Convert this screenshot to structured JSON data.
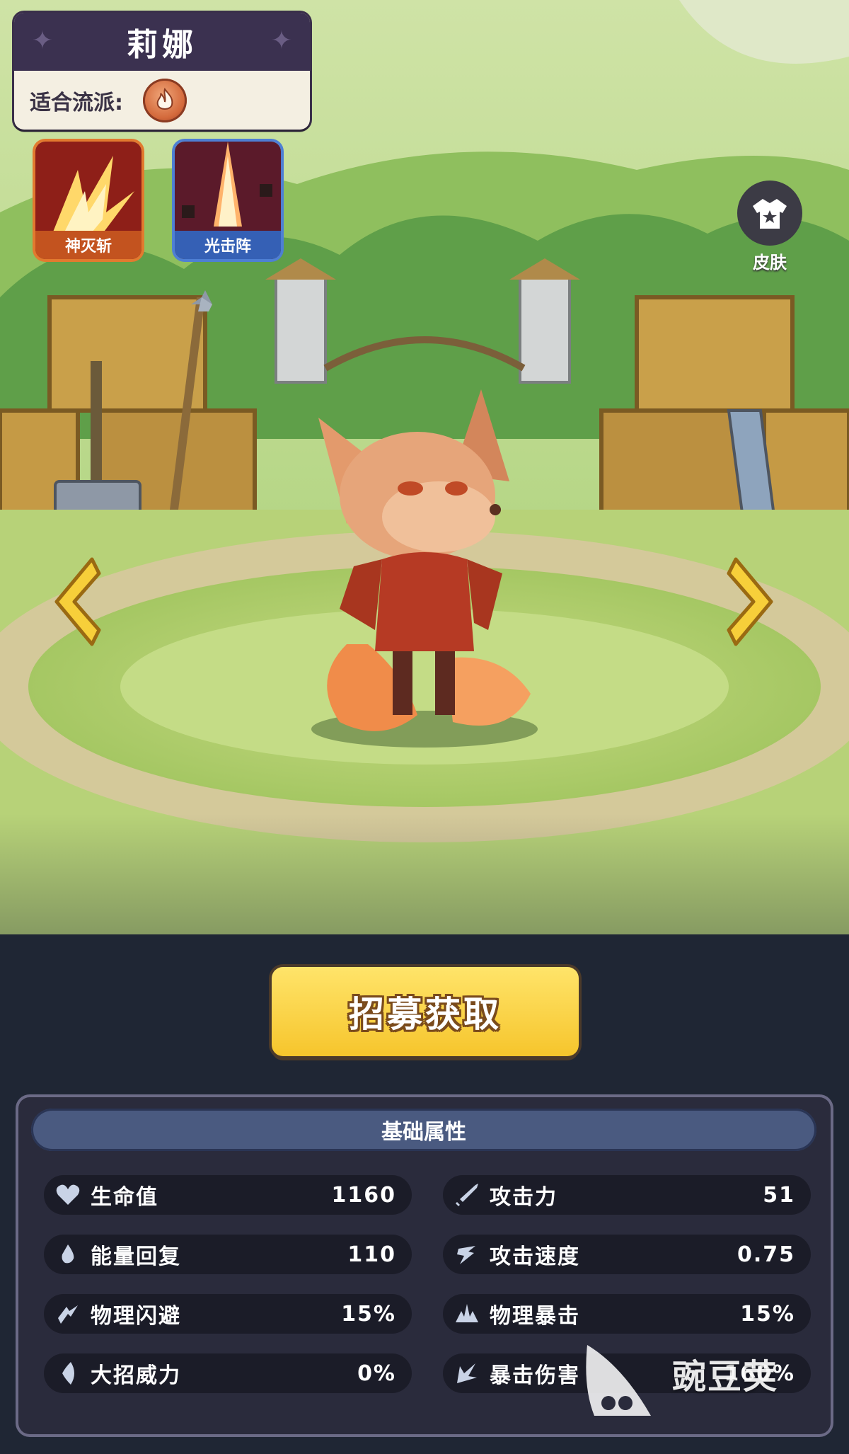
{
  "hero": {
    "name": "莉娜",
    "school_label": "适合流派:",
    "school_icon": "fire-flame-icon"
  },
  "skills": [
    {
      "label": "神灭斩",
      "icon": "flame-slash-icon",
      "color": "#c3531f"
    },
    {
      "label": "光击阵",
      "icon": "light-strike-icon",
      "color": "#3560b5"
    }
  ],
  "skin": {
    "label": "皮肤",
    "icon": "shirt-icon"
  },
  "nav": {
    "prev_icon": "chevron-left-icon",
    "next_icon": "chevron-right-icon"
  },
  "recruit": {
    "label": "招募获取"
  },
  "stats": {
    "title": "基础属性",
    "items": [
      {
        "name": "生命值",
        "value": "1160",
        "icon": "heart-icon"
      },
      {
        "name": "攻击力",
        "value": "51",
        "icon": "sword-icon"
      },
      {
        "name": "能量回复",
        "value": "110",
        "icon": "energy-drop-icon"
      },
      {
        "name": "攻击速度",
        "value": "0.75",
        "icon": "speed-icon"
      },
      {
        "name": "物理闪避",
        "value": "15%",
        "icon": "dodge-icon"
      },
      {
        "name": "物理暴击",
        "value": "15%",
        "icon": "crit-icon"
      },
      {
        "name": "大招威力",
        "value": "0%",
        "icon": "ultimate-icon"
      },
      {
        "name": "暴击伤害",
        "value": "160%",
        "icon": "crit-damage-icon"
      }
    ]
  },
  "watermark": {
    "text": "豌豆荚"
  },
  "colors": {
    "panel": "#2a2b3c",
    "stat_row": "#1b1c28",
    "accent_gold": "#f6c52c",
    "header_bar": "#3b3150"
  }
}
